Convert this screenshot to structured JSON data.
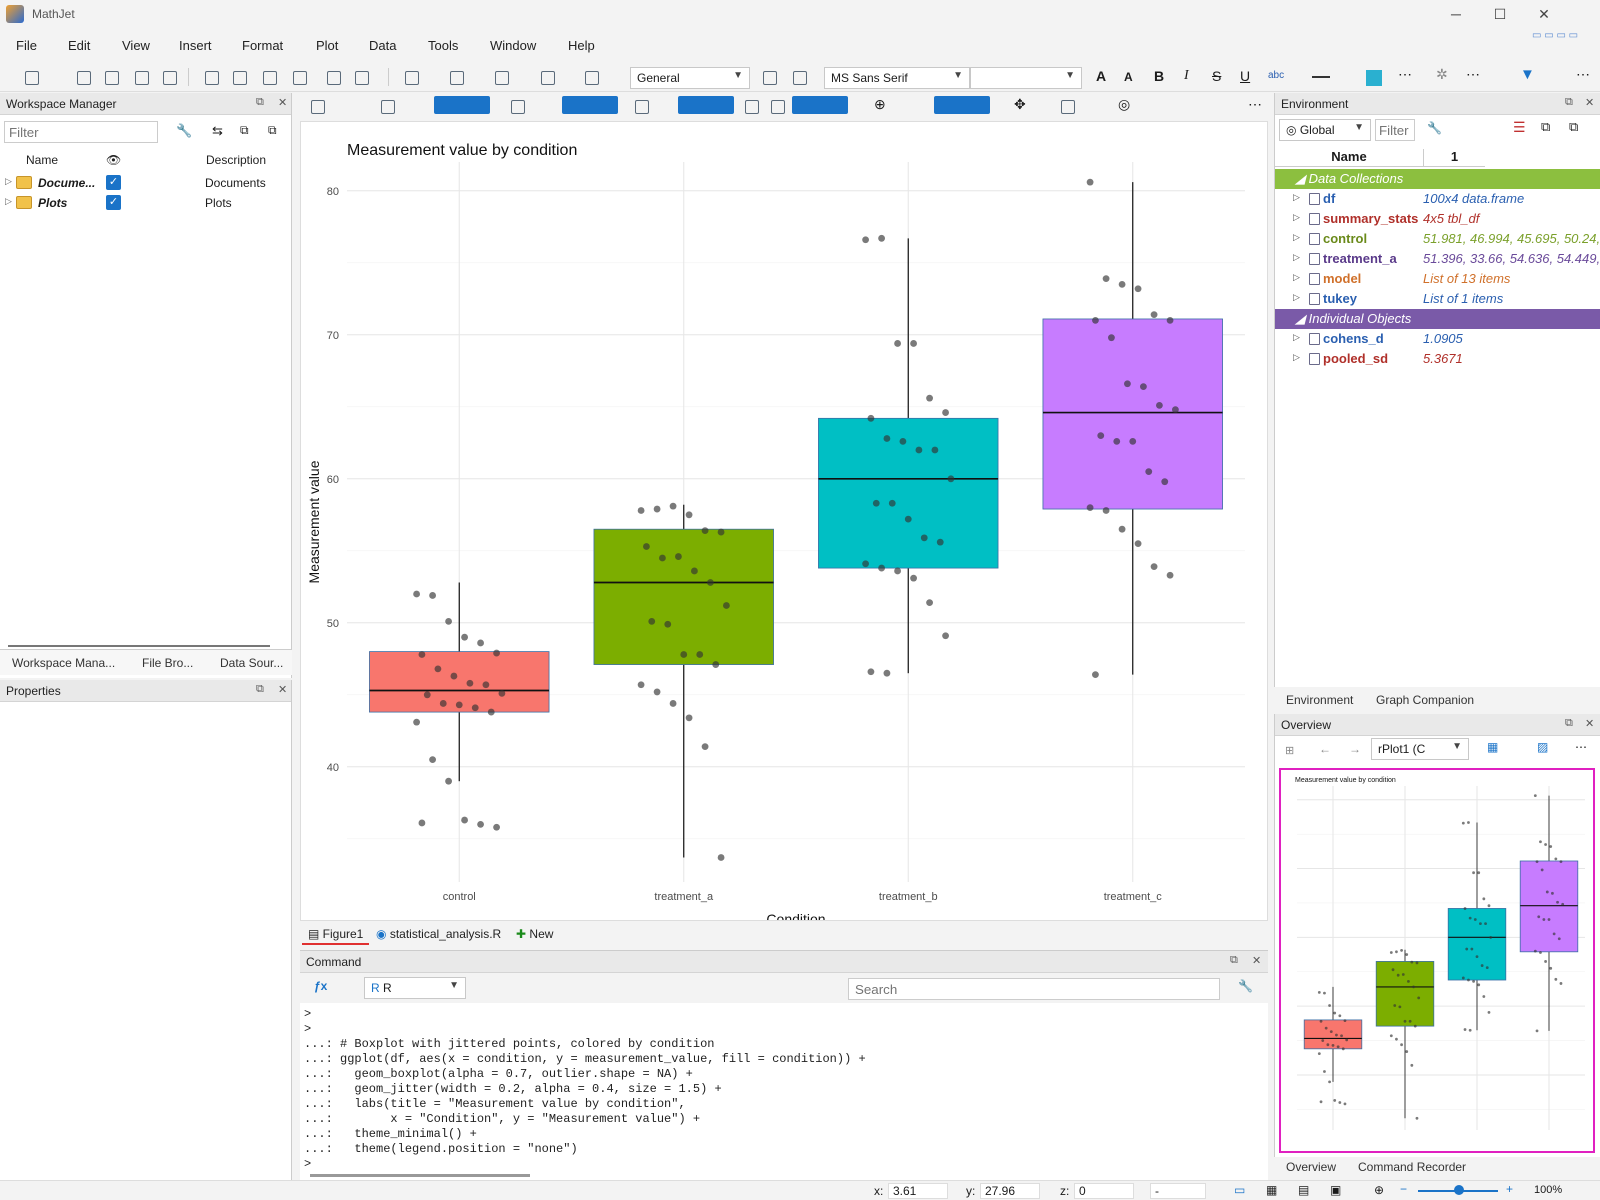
{
  "app": {
    "title": "MathJet"
  },
  "menu": [
    "File",
    "Edit",
    "View",
    "Insert",
    "Format",
    "Plot",
    "Data",
    "Tools",
    "Window",
    "Help"
  ],
  "toolbar": {
    "format_combo": "General",
    "font_combo": "MS Sans Serif"
  },
  "workspace": {
    "title": "Workspace Manager",
    "filter_placeholder": "Filter",
    "col_name": "Name",
    "col_desc": "Description",
    "rows": [
      {
        "name": "Docume...",
        "desc": "Documents"
      },
      {
        "name": "Plots",
        "desc": "Plots"
      }
    ],
    "tabs": [
      "Workspace Mana...",
      "File Bro...",
      "Data Sour..."
    ]
  },
  "properties": {
    "title": "Properties"
  },
  "doc_tabs": [
    "Figure1",
    "statistical_analysis.R",
    "New"
  ],
  "command": {
    "title": "Command",
    "language": "R",
    "search_placeholder": "Search",
    "lines": [
      ">",
      ">",
      "...: # Boxplot with jittered points, colored by condition",
      "...: ggplot(df, aes(x = condition, y = measurement_value, fill = condition)) +",
      "...:   geom_boxplot(alpha = 0.7, outlier.shape = NA) +",
      "...:   geom_jitter(width = 0.2, alpha = 0.4, size = 1.5) +",
      "...:   labs(title = \"Measurement value by condition\",",
      "...:        x = \"Condition\", y = \"Measurement value\") +",
      "...:   theme_minimal() +",
      "...:   theme(legend.position = \"none\")",
      ">"
    ]
  },
  "environment": {
    "title": "Environment",
    "scope": "Global",
    "filter_placeholder": "Filter",
    "col_name": "Name",
    "col_value": "1",
    "groups": [
      {
        "label": "Data Collections",
        "color": "#8cbf3f",
        "items": [
          {
            "name": "df",
            "value": "100x4 data.frame",
            "name_color": "#2a5fb0",
            "value_color": "#2a5fb0"
          },
          {
            "name": "summary_stats",
            "value": "4x5 tbl_df",
            "name_color": "#b0302a",
            "value_color": "#b0302a"
          },
          {
            "name": "control",
            "value": "51.981, 46.994, 45.695, 50.24,",
            "name_color": "#6a8a1a",
            "value_color": "#7aa02a"
          },
          {
            "name": "treatment_a",
            "value": "51.396, 33.66, 54.636, 54.449,",
            "name_color": "#5a3a8a",
            "value_color": "#6a4a9a"
          },
          {
            "name": "model",
            "value": "List of 13 items",
            "name_color": "#d0702a",
            "value_color": "#d0702a"
          },
          {
            "name": "tukey",
            "value": "List of 1 items",
            "name_color": "#2a5fb0",
            "value_color": "#2a5fb0"
          }
        ]
      },
      {
        "label": "Individual Objects",
        "color": "#7a5aa8",
        "items": [
          {
            "name": "cohens_d",
            "value": "1.0905",
            "name_color": "#2a5fb0",
            "value_color": "#2a5fb0"
          },
          {
            "name": "pooled_sd",
            "value": "5.3671",
            "name_color": "#b0302a",
            "value_color": "#b0302a"
          }
        ]
      }
    ],
    "tabs": [
      "Environment",
      "Graph Companion"
    ]
  },
  "overview": {
    "title": "Overview",
    "plot_combo": "rPlot1 (C",
    "tabs": [
      "Overview",
      "Command Recorder"
    ]
  },
  "status": {
    "x_label": "x:",
    "x_value": "3.61",
    "y_label": "y:",
    "y_value": "27.96",
    "z_label": "z:",
    "z_value": "0",
    "dash": "-",
    "zoom": "100%"
  },
  "chart_data": {
    "type": "box",
    "title": "Measurement value by condition",
    "xlabel": "Condition",
    "ylabel": "Measurement value",
    "categories": [
      "control",
      "treatment_a",
      "treatment_b",
      "treatment_c"
    ],
    "ylim": [
      32,
      82
    ],
    "yticks": [
      40,
      50,
      60,
      70,
      80
    ],
    "grid": true,
    "legend": "none",
    "colors": [
      "#f8766d",
      "#7cae00",
      "#00bfc4",
      "#c77cff"
    ],
    "boxes": [
      {
        "q1": 43.8,
        "median": 45.3,
        "q3": 48.0,
        "min": 39.0,
        "max": 52.8
      },
      {
        "q1": 47.1,
        "median": 52.8,
        "q3": 56.5,
        "min": 33.7,
        "max": 58.2
      },
      {
        "q1": 53.8,
        "median": 60.0,
        "q3": 64.2,
        "min": 46.5,
        "max": 76.7
      },
      {
        "q1": 57.9,
        "median": 64.6,
        "q3": 71.1,
        "min": 46.4,
        "max": 80.6
      }
    ],
    "points": [
      [
        52.0,
        51.9,
        50.1,
        49.0,
        48.6,
        47.9,
        47.8,
        46.8,
        46.3,
        45.8,
        45.7,
        45.1,
        45.0,
        44.4,
        44.3,
        44.1,
        43.8,
        43.1,
        40.5,
        39.0,
        36.3,
        36.0,
        35.8,
        36.1
      ],
      [
        57.8,
        57.9,
        58.1,
        57.5,
        56.4,
        56.3,
        55.3,
        54.5,
        54.6,
        53.6,
        52.8,
        51.2,
        50.1,
        49.9,
        47.8,
        47.8,
        47.1,
        45.7,
        45.2,
        44.4,
        43.4,
        41.4,
        33.7
      ],
      [
        76.6,
        76.7,
        69.4,
        69.4,
        65.6,
        64.6,
        64.2,
        62.8,
        62.6,
        62.0,
        62.0,
        60.0,
        58.3,
        58.3,
        57.2,
        55.9,
        55.6,
        54.1,
        53.8,
        53.6,
        53.1,
        51.4,
        49.1,
        46.6,
        46.5
      ],
      [
        80.6,
        73.9,
        73.5,
        73.2,
        71.4,
        71.0,
        71.0,
        69.8,
        66.6,
        66.4,
        65.1,
        64.8,
        63.0,
        62.6,
        62.6,
        60.5,
        59.8,
        58.0,
        57.8,
        56.5,
        55.5,
        53.9,
        53.3,
        46.4
      ]
    ]
  }
}
